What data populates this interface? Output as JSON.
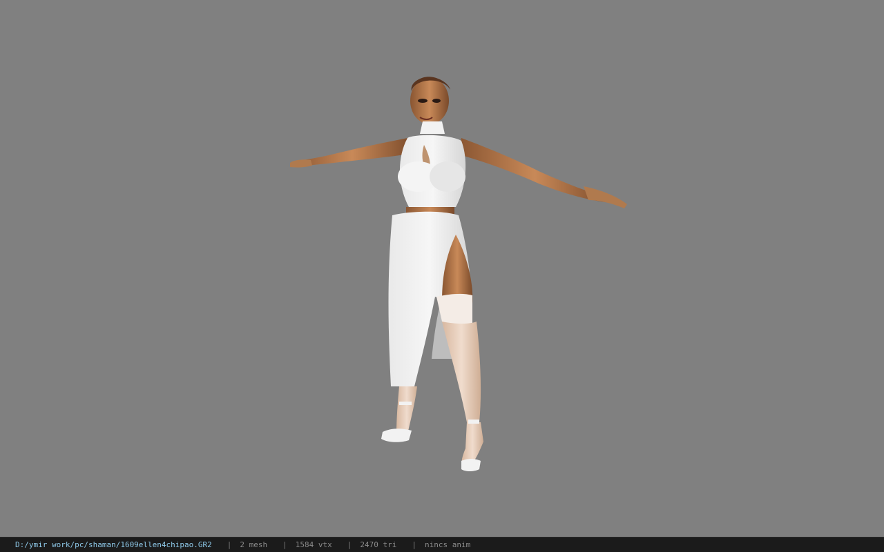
{
  "viewer": {
    "background_color": "#808080",
    "model_icon": "character-model-icon"
  },
  "status": {
    "file_path": "D:/ymir work/pc/shaman/1609ellen4chipao.GR2",
    "separator": "|",
    "mesh": "2 mesh",
    "vtx": "1584 vtx",
    "tri": "2470 tri",
    "anim": "nincs anim"
  }
}
